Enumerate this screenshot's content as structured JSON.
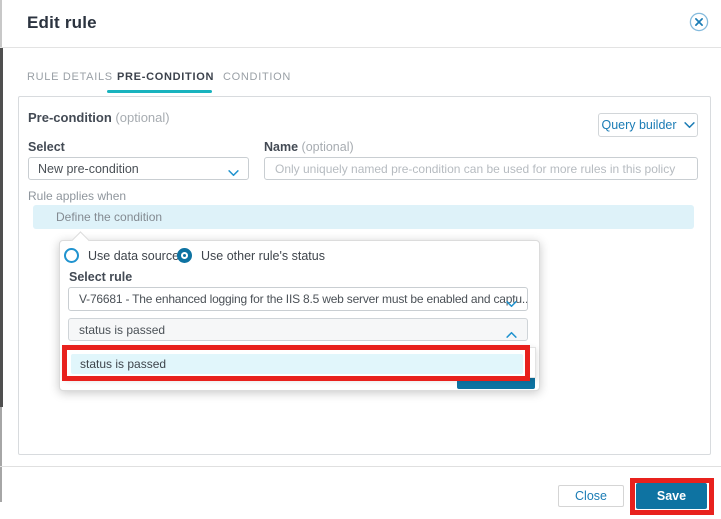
{
  "window": {
    "title": "Edit rule"
  },
  "tabs": {
    "rule_details": "RULE DETAILS",
    "pre_condition": "PRE-CONDITION",
    "condition": "CONDITION",
    "active": "PRE-CONDITION"
  },
  "precondition_panel": {
    "heading": "Pre-condition",
    "heading_suffix": "(optional)",
    "query_builder_label": "Query builder",
    "select_field": {
      "label": "Select",
      "value": "New pre-condition"
    },
    "name_field": {
      "label": "Name",
      "label_suffix": "(optional)",
      "value": "",
      "placeholder": "Only uniquely named pre-condition can be used for more rules in this policy"
    },
    "rule_applies_label": "Rule applies when",
    "condition_row_text": "Define the condition"
  },
  "condition_popup": {
    "radios": [
      {
        "label": "Use data source",
        "selected": false
      },
      {
        "label": "Use other rule's status",
        "selected": true
      }
    ],
    "select_rule_label": "Select rule",
    "rule_select_value": "V-76681 - The enhanced logging for the IIS 8.5 web server must be enabled and captu...",
    "status_select_value": "status is passed",
    "status_options": [
      "status is passed"
    ]
  },
  "footer": {
    "close_label": "Close",
    "save_label": "Save"
  },
  "icons": {
    "close": "circled-x",
    "dropdown_collapsed": "chevron-down",
    "dropdown_expanded": "chevron-up"
  },
  "colors": {
    "tab_accent_teal": "#19b3be",
    "link_blue": "#1b7cb5",
    "chevron_blue": "#2093cf",
    "primary_button_blue": "#0e73a2",
    "annotation_red": "#e8211d",
    "condition_row_highlight": "#def2f9",
    "option_highlight": "#e1f6fb"
  }
}
